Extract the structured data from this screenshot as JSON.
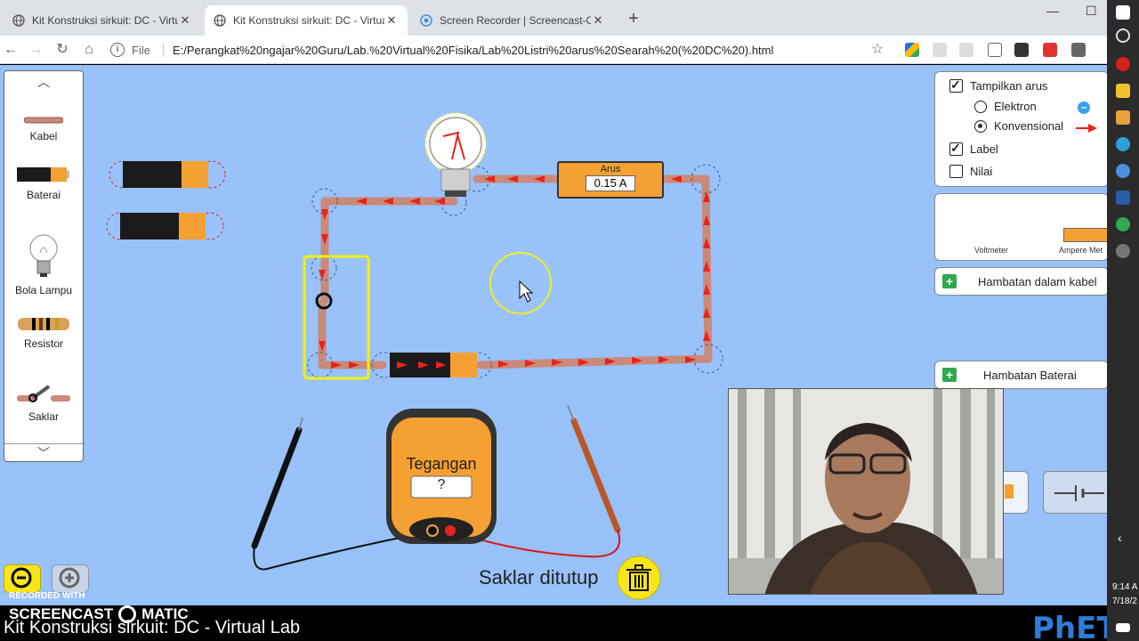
{
  "browser": {
    "tabs": [
      {
        "title": "Kit Konstruksi sirkuit: DC - Virtual",
        "active": false
      },
      {
        "title": "Kit Konstruksi sirkuit: DC - Virtual",
        "active": true
      },
      {
        "title": "Screen Recorder | Screencast-O-M",
        "active": false
      }
    ],
    "new_tab": "+",
    "address_prefix": "File",
    "url": "E:/Perangkat%20ngajar%20Guru/Lab.%20Virtual%20Fisika/Lab%20Listri%20arus%20Searah%20(%20DC%20).html"
  },
  "toolbox": {
    "items": [
      {
        "label": "Kabel"
      },
      {
        "label": "Baterai"
      },
      {
        "label": "Bola Lampu"
      },
      {
        "label": "Resistor"
      },
      {
        "label": "Saklar"
      }
    ]
  },
  "controls": {
    "show_current_label": "Tampilkan arus",
    "show_current_checked": true,
    "electron_label": "Elektron",
    "electron_selected": false,
    "conventional_label": "Konvensional",
    "conventional_selected": true,
    "label_option": "Label",
    "label_checked": true,
    "value_option": "Nilai",
    "value_checked": false
  },
  "meters_panel": {
    "voltmeter_label": "Voltmeter",
    "ammeter_label": "Ampere Met"
  },
  "wire_resistance": {
    "label": "Hambatan dalam kabel"
  },
  "battery_resistance": {
    "label": "Hambatan Baterai"
  },
  "ammeter": {
    "title": "Arus",
    "reading": "0.15 A"
  },
  "voltmeter": {
    "title": "Tegangan",
    "reading": "?"
  },
  "switch_status": "Saklar ditutup",
  "watermark": {
    "recorded_with": "RECORDED WITH",
    "brand": "SCREENCAST",
    "brand2": "MATIC"
  },
  "caption": "Kit Konstruksi sirkuit: DC - Virtual Lab",
  "phet_logo": "PhET",
  "clock": {
    "time": "9:14 A",
    "date": "7/18/2"
  },
  "colors": {
    "lab_bg": "#99c2fb",
    "wire": "#c98a7a",
    "arrow": "#e8231b",
    "battery_orange": "#f5a032",
    "switch_highlight": "#f2f200",
    "plus_green": "#2fa84f",
    "zoom_yellow": "#f7e51a"
  }
}
